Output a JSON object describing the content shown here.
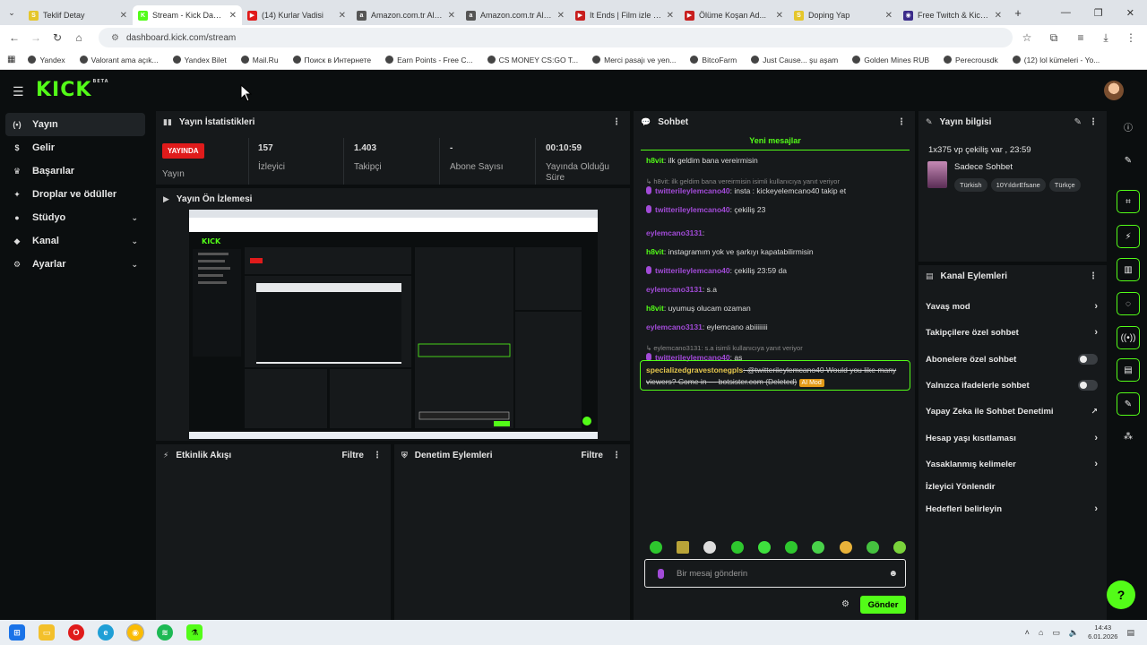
{
  "browser": {
    "tabs": [
      {
        "title": "Teklif Detay",
        "fav": "S",
        "color": "#e5c62b"
      },
      {
        "title": "Stream - Kick Dashbo...",
        "fav": "K",
        "color": "#53fc18",
        "active": true
      },
      {
        "title": "(14) Kurlar Vadisi",
        "fav": "▶",
        "color": "#e01b1b"
      },
      {
        "title": "Amazon.com.tr Alışv...",
        "fav": "a",
        "color": "#555555"
      },
      {
        "title": "Amazon.com.tr Alışv...",
        "fav": "a",
        "color": "#555555"
      },
      {
        "title": "It Ends | Film izle | HD...",
        "fav": "▶",
        "color": "#c81e1e"
      },
      {
        "title": "Ölüme Koşan Ad...",
        "fav": "▶",
        "color": "#c81e1e"
      },
      {
        "title": "Doping Yap",
        "fav": "S",
        "color": "#e5c62b"
      },
      {
        "title": "Free Twitch & Kick V...",
        "fav": "◉",
        "color": "#3b2b8a"
      }
    ],
    "url": "dashboard.kick.com/stream",
    "bookmarks": [
      "Yandex",
      "Valorant ama açık...",
      "Yandex Bilet",
      "Mail.Ru",
      "Поиск в Интернете",
      "Earn Points - Free C...",
      "CS MONEY CS:GO T...",
      "Merci pasajı ve yen...",
      "BitcoFarm",
      "Just Cause... şu aşam",
      "Golden Mines RUB",
      "Perecrousdk",
      "(12) lol kümeleri - Yo..."
    ]
  },
  "sidebar": {
    "items": [
      {
        "label": "Yayın",
        "icon": "broadcast-icon",
        "glyph": "(•)"
      },
      {
        "label": "Gelir",
        "icon": "money-icon",
        "glyph": "$"
      },
      {
        "label": "Başarılar",
        "icon": "trophy-icon",
        "glyph": "♛"
      },
      {
        "label": "Droplar ve ödüller",
        "icon": "gift-icon",
        "glyph": "✦"
      },
      {
        "label": "Stüdyo",
        "icon": "studio-icon",
        "glyph": "●"
      },
      {
        "label": "Kanal",
        "icon": "channel-icon",
        "glyph": "◆"
      },
      {
        "label": "Ayarlar",
        "icon": "settings-icon",
        "glyph": "⚙"
      }
    ]
  },
  "stats": {
    "title": "Yayın İstatistikleri",
    "live_badge": "YAYINDA",
    "live_label": "Yayın",
    "viewers_value": "157",
    "viewers_label": "İzleyici",
    "followers_value": "1.403",
    "followers_label": "Takipçi",
    "subs_value": "-",
    "subs_label": "Abone Sayısı",
    "duration_value": "00:10:59",
    "duration_label": "Yayında Olduğu Süre"
  },
  "preview": {
    "title": "Yayın Ön İzlemesi"
  },
  "activity": {
    "title": "Etkinlik Akışı",
    "filter": "Filtre"
  },
  "moderation": {
    "title": "Denetim Eylemleri",
    "filter": "Filtre"
  },
  "chat": {
    "title": "Sohbet",
    "new_messages": "Yeni mesajlar",
    "messages": [
      {
        "user": "h8vit",
        "color": "#53fc18",
        "text": ": ilk geldim bana vereirmisin"
      },
      {
        "reply": "h8vit: ilk geldim bana vereirmisin isimli kullanıcıya yanıt veriyor"
      },
      {
        "user": "twitterileylemcano40",
        "color": "#a24bd8",
        "text": ": insta : kickeyelemcano40 takip et",
        "mic": true
      },
      {
        "user": "twitterileylemcano40",
        "color": "#a24bd8",
        "text": ": çekiliş 23",
        "mic": true
      },
      {
        "user": "eylemcano3131",
        "color": "#a24bd8",
        "text": ":"
      },
      {
        "user": "h8vit",
        "color": "#53fc18",
        "text": ": instagramım yok ve şarkıyı kapatabilirmisin"
      },
      {
        "user": "twitterileylemcano40",
        "color": "#a24bd8",
        "text": ": çekiliş 23:59 da",
        "mic": true
      },
      {
        "user": "eylemcano3131",
        "color": "#a24bd8",
        "text": ": s.a"
      },
      {
        "user": "h8vit",
        "color": "#53fc18",
        "text": ": uyumuş olucam ozaman"
      },
      {
        "user": "eylemcano3131",
        "color": "#a24bd8",
        "text": ": eylemcano abiiiiiiii"
      },
      {
        "reply": "eylemcano3131: s.a isimli kullanıcıya yanıt veriyor"
      },
      {
        "user": "twitterileylemcano40",
        "color": "#a24bd8",
        "text": ": as",
        "mic": true
      }
    ],
    "spam_user": "specializedgravestonegpls",
    "spam_text": ": @twitterileylemcano40 Would you like many viewers? Come in — botsister.com (Deleted)",
    "spam_badge": "AI Mod",
    "input_placeholder": "Bir mesaj gönderin",
    "send": "Gönder"
  },
  "stream_info": {
    "title": "Yayın bilgisi",
    "stream_title": "1x375 vp çekiliş var , 23:59",
    "category": "Sadece Sohbet",
    "tags": [
      "Türkish",
      "10YıldırEfsane",
      "Türkçe"
    ]
  },
  "channel_actions": {
    "title": "Kanal Eylemleri",
    "items": [
      {
        "label": "Yavaş mod",
        "kind": "chev"
      },
      {
        "label": "Takipçilere özel sohbet",
        "kind": "chev"
      },
      {
        "label": "Abonelere özel sohbet",
        "kind": "toggle"
      },
      {
        "label": "Yalnızca ifadelerle sohbet",
        "kind": "toggle"
      },
      {
        "label": "Yapay Zeka ile Sohbet Denetimi",
        "kind": "ext"
      },
      {
        "label": "Hesap yaşı kısıtlaması",
        "kind": "chev"
      },
      {
        "label": "Yasaklanmış kelimeler",
        "kind": "chev"
      },
      {
        "label": "İzleyici Yönlendir",
        "kind": "none"
      },
      {
        "label": "Hedefleri belirleyin",
        "kind": "chev"
      }
    ]
  },
  "taskbar": {
    "time": "14:43",
    "date": "6.01.2026"
  },
  "colors": {
    "accent": "#53fc18",
    "live": "#e01b1b",
    "panel": "#16191b",
    "bg": "#0b0e0f"
  }
}
